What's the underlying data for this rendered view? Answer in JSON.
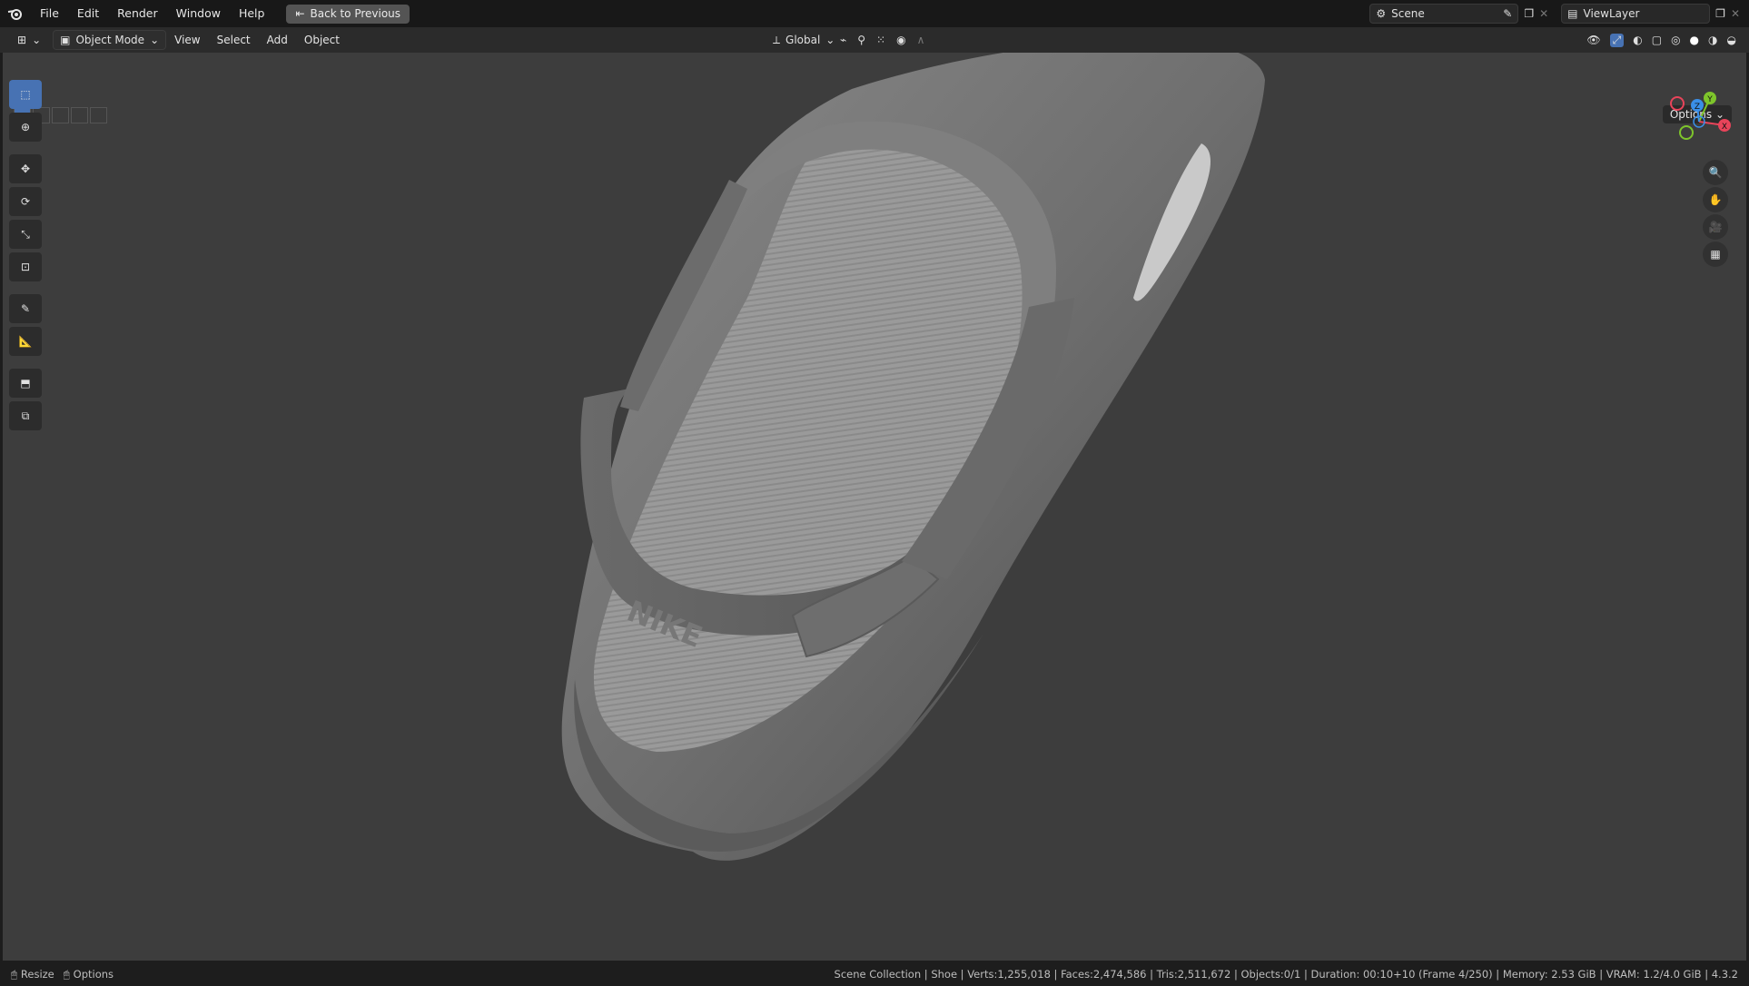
{
  "menubar": {
    "items": [
      "File",
      "Edit",
      "Render",
      "Window",
      "Help"
    ],
    "back_button": "Back to Previous",
    "scene_label": "Scene",
    "viewlayer_label": "ViewLayer"
  },
  "viewport_header": {
    "mode": "Object Mode",
    "menus": [
      "View",
      "Select",
      "Add",
      "Object"
    ],
    "transform_orientation": "Global",
    "options": "Options"
  },
  "model": {
    "logo_text": "NIKE"
  },
  "gizmo": {
    "y": "Y",
    "z": "Z",
    "x": "X",
    "colors": {
      "x": "#e8445a",
      "y": "#7ec52b",
      "z": "#3a8fe8"
    }
  },
  "statusbar": {
    "left_items": [
      "Resize",
      "Options"
    ],
    "info": "Scene Collection | Shoe | Verts:1,255,018 | Faces:2,474,586 | Tris:2,511,672 | Objects:0/1 | Duration: 00:10+10 (Frame 4/250) | Memory: 2.53 GiB | VRAM: 1.2/4.0 GiB | 4.3.2"
  },
  "colors": {
    "viewport_bg": "#3d3d3d",
    "accent": "#4772b3"
  }
}
